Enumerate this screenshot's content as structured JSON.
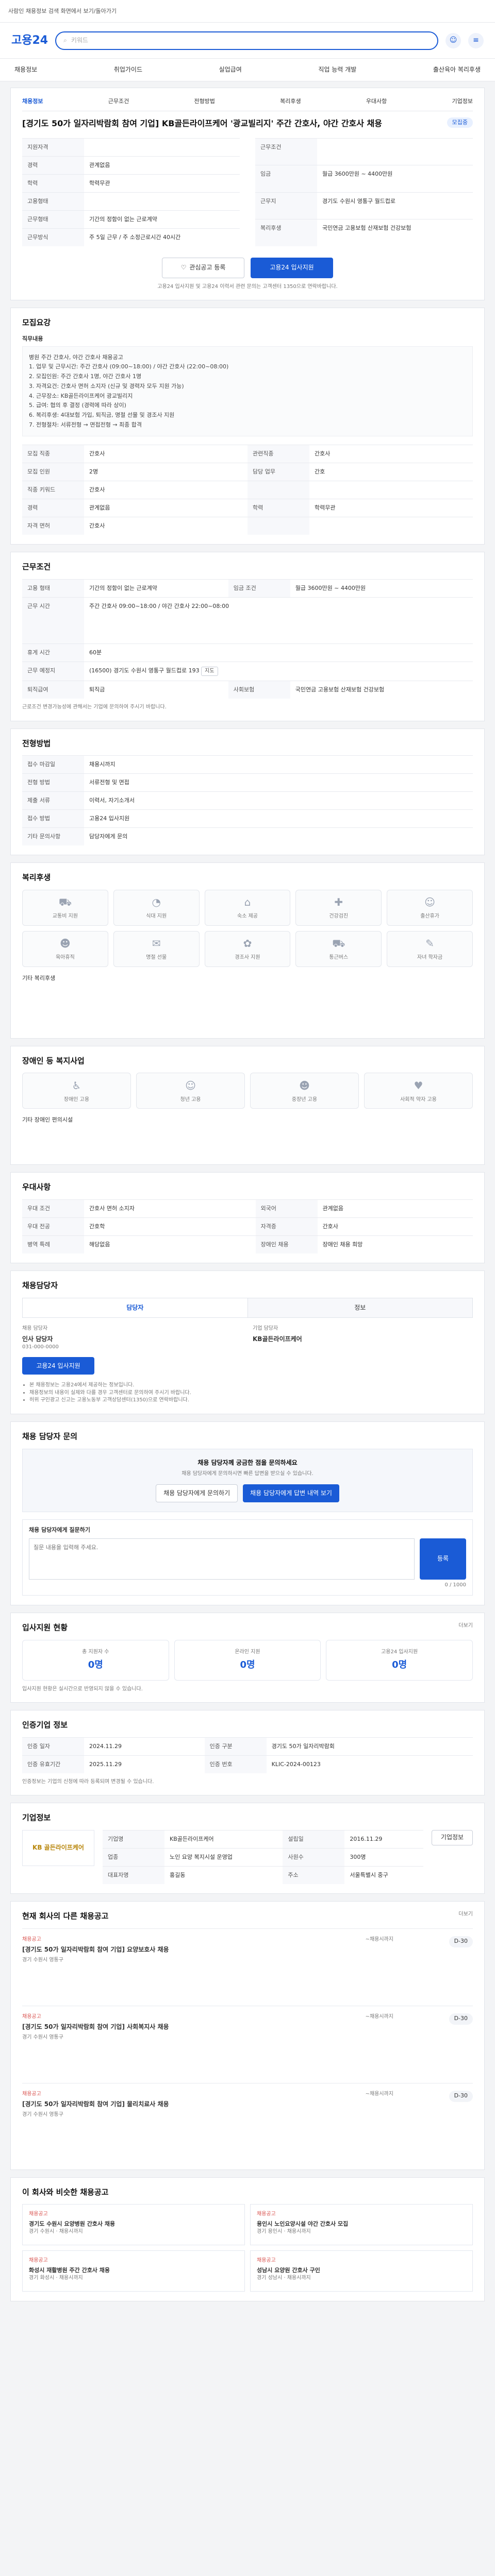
{
  "header": {
    "banner_text": "사람인 채용정보 검색 화면에서 보기/돌아가기",
    "logo": "고용24",
    "search_placeholder": "키워드",
    "nav": [
      "채용정보",
      "취업가이드",
      "실업급여",
      "직업 능력 개발",
      "출산육아 복리후생"
    ]
  },
  "job": {
    "top_tabs": [
      "채용정보",
      "근무조건",
      "전형방법",
      "복리후생",
      "우대사항",
      "기업정보"
    ],
    "title": "[경기도 50가 일자리박람회 참여 기업] KB골든라이프케어 '광교빌리지' 주간 간호사, 야간 간호사 채용",
    "badge": "모집중",
    "left_info": [
      {
        "k": "지원자격",
        "v": ""
      },
      {
        "k": "경력",
        "v": "관계없음"
      },
      {
        "k": "학력",
        "v": "학력무관"
      },
      {
        "k": "고용형태",
        "v": ""
      },
      {
        "k": "근무형태",
        "v": "기간의 정함이 없는 근로계약"
      },
      {
        "k": "근무방식",
        "v": "주 5일 근무 / 주 소정근로시간 40시간"
      }
    ],
    "right_info": [
      {
        "k": "근무조건",
        "v": ""
      },
      {
        "k": "임금",
        "v": "월급 3600만원 ~ 4400만원"
      },
      {
        "k": "근무지",
        "v": "경기도 수원시 영통구 월드컵로"
      },
      {
        "k": "복리후생",
        "v": "국민연금 고용보험 산재보험 건강보험"
      }
    ],
    "apply_save": "관심공고 등록",
    "apply_btn": "고용24 입사지원",
    "apply_note": "고용24 입사지원 및 고용24 이력서 관련 문의는 고객센터 1350으로 연락바랍니다."
  },
  "sections": {
    "recruit": {
      "title": "모집요강",
      "job_label": "직무내용",
      "body": "병원 주간 간호사, 야간 간호사 채용공고\n1. 업무 및 근무시간: 주간 간호사 (09:00~18:00) / 야간 간호사 (22:00~08:00)\n2. 모집인원: 주간 간호사 1명, 야간 간호사 1명\n3. 자격요건: 간호사 면허 소지자 (신규 및 경력자 모두 지원 가능)\n4. 근무장소: KB골든라이프케어 광교빌리지\n5. 급여: 협의 후 결정 (경력에 따라 상이)\n6. 복리후생: 4대보험 가입, 퇴직금, 명절 선물 및 경조사 지원\n7. 전형절차: 서류전형 → 면접전형 → 최종 합격",
      "rows": [
        {
          "k": "모집 직종",
          "v": "간호사",
          "k2": "관련직종",
          "v2": "간호사"
        },
        {
          "k": "모집 인원",
          "v": "2명",
          "k2": "담당 업무",
          "v2": "간호"
        },
        {
          "k": "직종 키워드",
          "v": "간호사",
          "k2": "",
          "v2": ""
        },
        {
          "k": "경력",
          "v": "관계없음",
          "k2": "학력",
          "v2": "학력무관"
        },
        {
          "k": "자격 면허",
          "v": "간호사",
          "k2": "",
          "v2": ""
        }
      ]
    },
    "work": {
      "title": "근무조건",
      "rows": [
        {
          "k": "고용 형태",
          "v": "기간의 정함이 없는 근로계약",
          "k2": "임금 조건",
          "v2": "월급 3600만원 ~ 4400만원"
        },
        {
          "k": "근무 시간",
          "v": "주간 간호사 09:00~18:00 / 야간 간호사 22:00~08:00",
          "k2": "",
          "v2": ""
        },
        {
          "k": "휴게 시간",
          "v": "60분",
          "k2": "",
          "v2": ""
        },
        {
          "k": "근무 예정지",
          "v": "(16500) 경기도 수원시 영통구 월드컵로 193",
          "k2": "",
          "v2": ""
        },
        {
          "k": "퇴직급여",
          "v": "퇴직금",
          "k2": "사회보험",
          "v2": "국민연금 고용보험 산재보험 건강보험"
        }
      ],
      "note": "근로조건 변경가능성에 관해서는 기업에 문의하여 주시기 바랍니다."
    },
    "selection": {
      "title": "전형방법",
      "rows": [
        {
          "k": "접수 마감일",
          "v": "채용시까지"
        },
        {
          "k": "전형 방법",
          "v": "서류전형 및 면접"
        },
        {
          "k": "제출 서류",
          "v": "이력서, 자기소개서"
        },
        {
          "k": "접수 방법",
          "v": "고용24 입사지원"
        },
        {
          "k": "기타 문의사항",
          "v": "담당자에게 문의"
        }
      ]
    },
    "benefit": {
      "title": "복리후생",
      "items": [
        "교통비 지원",
        "식대 지원",
        "숙소 제공",
        "건강검진",
        "출산휴가",
        "육아휴직",
        "명절 선물",
        "경조사 지원",
        "통근버스",
        "자녀 학자금"
      ],
      "extra_label": "기타 복리후생"
    },
    "welfare_program": {
      "title": "장애인 등 복지사업",
      "items": [
        "장애인 고용",
        "청년 고용",
        "중장년 고용",
        "사회적 약자 고용"
      ],
      "extra": "기타 장애인 편의시설"
    },
    "preference": {
      "title": "우대사항",
      "rows": [
        {
          "k": "우대 조건",
          "v": "간호사 면허 소지자",
          "k2": "외국어",
          "v2": "관계없음"
        },
        {
          "k": "우대 전공",
          "v": "간호학",
          "k2": "자격증",
          "v2": "간호사"
        },
        {
          "k": "병역 특례",
          "v": "해당없음",
          "k2": "장애인 채용",
          "v2": "장애인 채용 희망"
        }
      ]
    },
    "contact": {
      "title": "채용담당자",
      "tabs": [
        "담당자",
        "정보"
      ],
      "left_label": "채용 담당자",
      "left_name": "인사 담당자",
      "left_phone": "031-000-0000",
      "apply": "고용24 입사지원",
      "right_label": "기업 담당자",
      "right_name": "KB골든라이프케어",
      "notes": [
        "본 채용정보는 고용24에서 제공하는 정보입니다.",
        "채용정보의 내용이 실제와 다를 경우 고객센터로 문의하여 주시기 바랍니다.",
        "허위 구인광고 신고는 고용노동부 고객상담센터(1350)으로 연락바랍니다."
      ]
    },
    "qna": {
      "title": "채용 담당자 문의",
      "notice_title": "채용 담당자께 궁금한 점을 문의하세요",
      "notice_body": "채용 담당자에게 문의하시면 빠른 답변을 받으실 수 있습니다.",
      "btn1": "채용 담당자에게 문의하기",
      "btn2": "채용 담당자에게 답변 내역 보기",
      "form_title": "채용 담당자에게 질문하기",
      "form_placeholder": "질문 내용을 입력해 주세요.",
      "counter": "0 / 1000",
      "submit": "등록"
    },
    "stats": {
      "title": "입사지원 현황",
      "link": "더보기",
      "items": [
        {
          "label": "총 지원자 수",
          "value": "0명"
        },
        {
          "label": "온라인 지원",
          "value": "0명"
        },
        {
          "label": "고용24 입사지원",
          "value": "0명"
        }
      ],
      "note": "입사지원 현황은 실시간으로 반영되지 않을 수 있습니다."
    },
    "announce": {
      "title": "인증기업 정보",
      "rows": [
        {
          "k": "인증 일자",
          "v": "2024.11.29",
          "k2": "인증 구분",
          "v2": "경기도 50가 일자리박람회"
        },
        {
          "k": "인증 유효기간",
          "v": "2025.11.29",
          "k2": "인증 번호",
          "v2": "KLIC-2024-00123"
        }
      ],
      "note": "인증정보는 기업의 신청에 따라 등록되며 변경될 수 있습니다."
    },
    "company": {
      "title": "기업정보",
      "logo_text": "KB 골든라이프케어",
      "rows": [
        {
          "k": "기업명",
          "v": "KB골든라이프케어",
          "k2": "설립일",
          "v2": "2016.11.29"
        },
        {
          "k": "업종",
          "v": "노인 요양 복지시설 운영업",
          "k2": "사원수",
          "v2": "300명"
        },
        {
          "k": "대표자명",
          "v": "홍길동",
          "k2": "주소",
          "v2": "서울특별시 중구"
        }
      ],
      "btn": "기업정보"
    },
    "company_jobs": {
      "title": "현재 회사의 다른 채용공고",
      "link": "더보기",
      "items": [
        {
          "tag": "채용공고",
          "title": "[경기도 50가 일자리박람회 참여 기업] 요양보호사 채용",
          "meta": "경기 수원시 영통구",
          "date": "~채용시까지",
          "badge": "D-30"
        },
        {
          "tag": "채용공고",
          "title": "[경기도 50가 일자리박람회 참여 기업] 사회복지사 채용",
          "meta": "경기 수원시 영통구",
          "date": "~채용시까지",
          "badge": "D-30"
        },
        {
          "tag": "채용공고",
          "title": "[경기도 50가 일자리박람회 참여 기업] 물리치료사 채용",
          "meta": "경기 수원시 영통구",
          "date": "~채용시까지",
          "badge": "D-30"
        }
      ]
    },
    "similar": {
      "title": "이 회사와 비슷한 채용공고",
      "items": [
        {
          "tag": "채용공고",
          "title": "경기도 수원시 요양병원 간호사 채용",
          "meta": "경기 수원시 · 채용시까지"
        },
        {
          "tag": "채용공고",
          "title": "용인시 노인요양시설 야간 간호사 모집",
          "meta": "경기 용인시 · 채용시까지"
        },
        {
          "tag": "채용공고",
          "title": "화성시 재활병원 주간 간호사 채용",
          "meta": "경기 화성시 · 채용시까지"
        },
        {
          "tag": "채용공고",
          "title": "성남시 요양원 간호사 구인",
          "meta": "경기 성남시 · 채용시까지"
        }
      ]
    }
  }
}
